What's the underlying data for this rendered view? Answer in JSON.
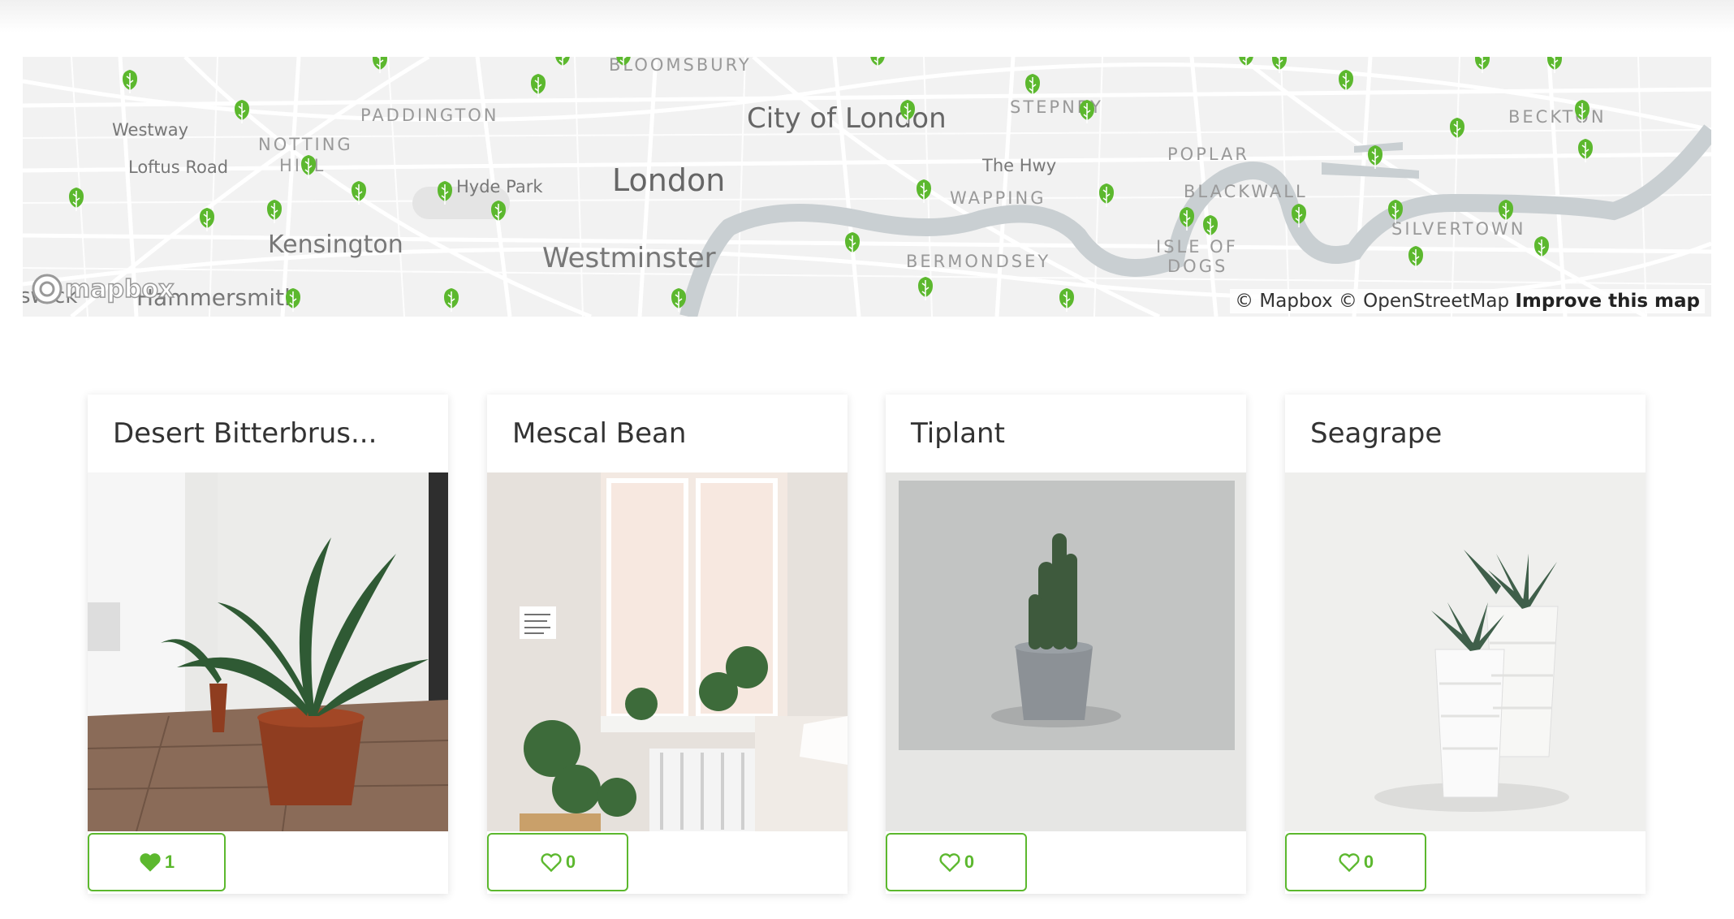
{
  "map": {
    "labels": {
      "bloomsbury": "BLOOMSBURY",
      "westway": "Westway",
      "paddington": "PADDINGTON",
      "city_of_london": "City of London",
      "stepney": "STEPNEY",
      "beckton": "BECKTON",
      "notting_hill_line1": "NOTTING",
      "notting_hill_line2": "HILL",
      "loftus_road": "Loftus Road",
      "poplar": "POPLAR",
      "the_hwy": "The Hwy",
      "hyde_park": "Hyde Park",
      "london": "London",
      "wapping": "WAPPING",
      "blackwall": "BLACKWALL",
      "kensington": "Kensington",
      "silvertown": "SILVERTOWN",
      "isle_of_dogs_line1": "ISLE OF",
      "isle_of_dogs_line2": "DOGS",
      "westminster": "Westminster",
      "bermondsey": "BERMONDSEY",
      "chiswick": "swick",
      "hammersmith": "Hammersmith"
    },
    "logo_text": "mapbox",
    "attribution": {
      "mapbox": "© Mapbox",
      "osm": "© OpenStreetMap",
      "improve": "Improve this map"
    },
    "pin_icon": "leaf-pin-icon",
    "pin_color": "#5cb82e"
  },
  "plants": [
    {
      "name": "Desert Bitterbrus...",
      "likes": "1",
      "liked": true
    },
    {
      "name": "Mescal Bean",
      "likes": "0",
      "liked": false
    },
    {
      "name": "Tiplant",
      "likes": "0",
      "liked": false
    },
    {
      "name": "Seagrape",
      "likes": "0",
      "liked": false
    }
  ],
  "colors": {
    "accent": "#5cb82e",
    "card_title": "#333333",
    "map_background": "#f2f2f2",
    "river": "#c9cfd2"
  }
}
